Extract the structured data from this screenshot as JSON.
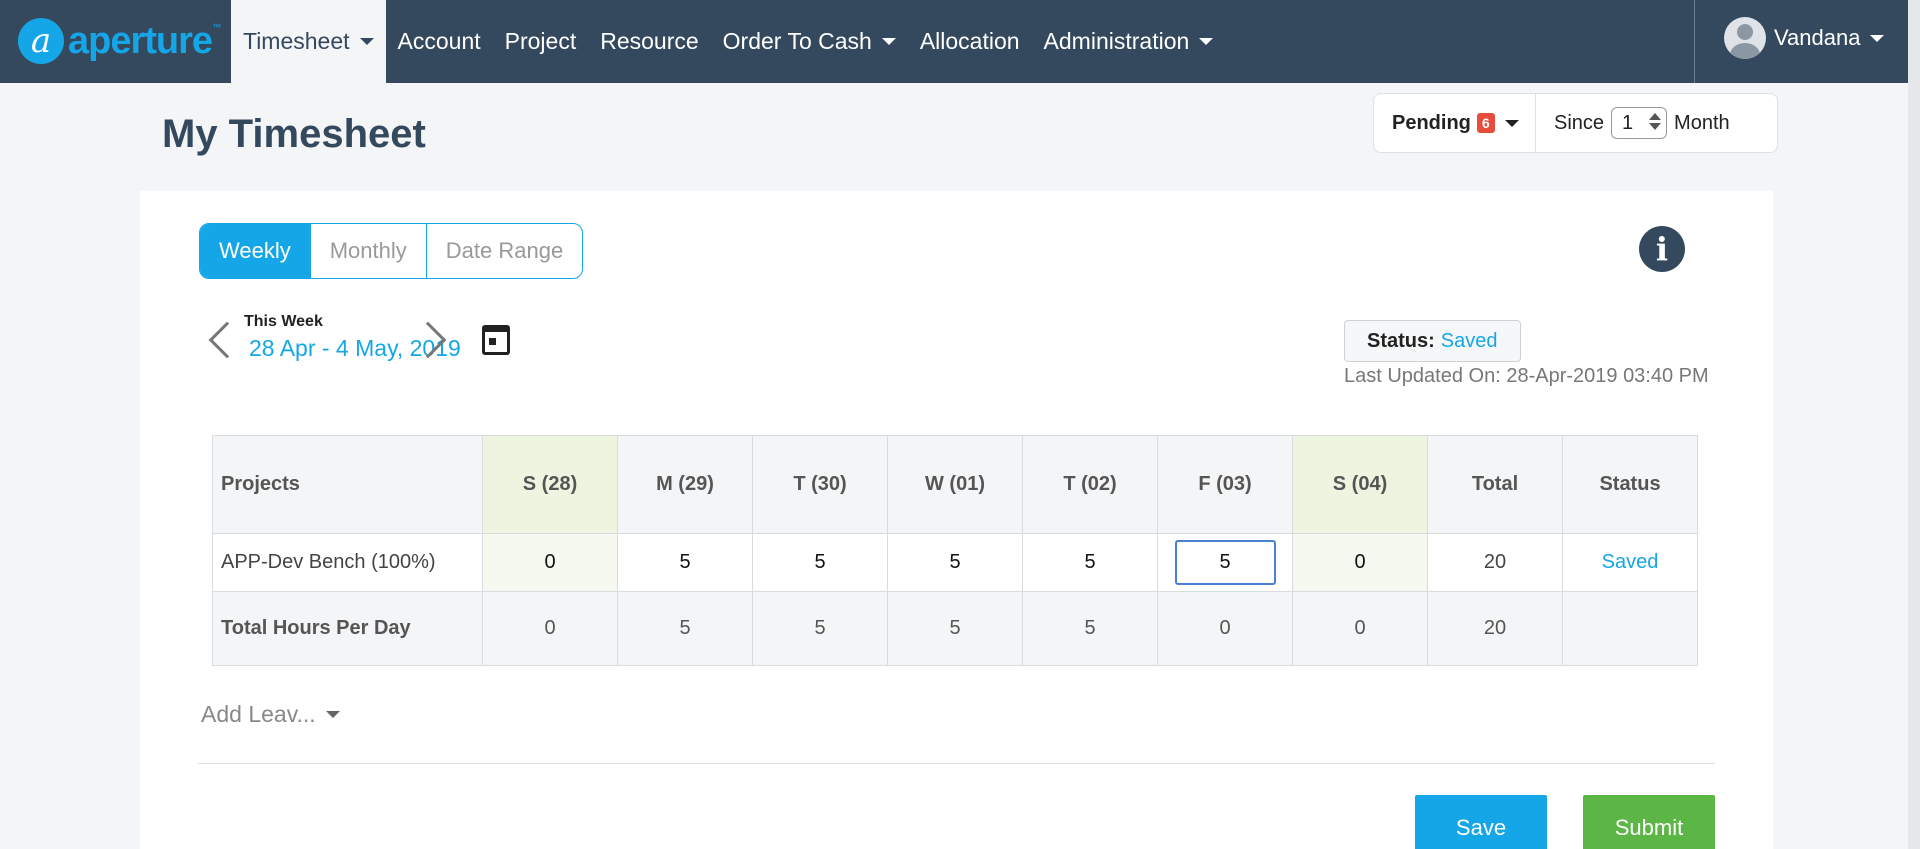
{
  "brand": {
    "mark": "a",
    "name": "aperture",
    "tm": "™"
  },
  "nav": {
    "items": [
      {
        "label": "Timesheet",
        "active": true,
        "dropdown": true
      },
      {
        "label": "Account",
        "active": false,
        "dropdown": false
      },
      {
        "label": "Project",
        "active": false,
        "dropdown": false
      },
      {
        "label": "Resource",
        "active": false,
        "dropdown": false
      },
      {
        "label": "Order To Cash",
        "active": false,
        "dropdown": true
      },
      {
        "label": "Allocation",
        "active": false,
        "dropdown": false
      },
      {
        "label": "Administration",
        "active": false,
        "dropdown": true
      }
    ],
    "user": "Vandana"
  },
  "page": {
    "title": "My Timesheet",
    "pending_label": "Pending",
    "pending_count": "6",
    "since_label": "Since",
    "since_value": "1",
    "since_unit": "Month"
  },
  "view_toggle": {
    "options": [
      "Weekly",
      "Monthly",
      "Date Range"
    ],
    "selected": "Weekly"
  },
  "week": {
    "label": "This Week",
    "range": "28 Apr - 4 May, 2019"
  },
  "status": {
    "label": "Status:",
    "value": "Saved",
    "last_updated": "Last Updated On: 28-Apr-2019 03:40 PM"
  },
  "table": {
    "headers": [
      "Projects",
      "S (28)",
      "M (29)",
      "T (30)",
      "W (01)",
      "T (02)",
      "F (03)",
      "S (04)",
      "Total",
      "Status"
    ],
    "row": {
      "project": "APP-Dev Bench (100%)",
      "hours": [
        "0",
        "5",
        "5",
        "5",
        "5",
        "5",
        "0"
      ],
      "total": "20",
      "status": "Saved"
    },
    "totals": {
      "label": "Total Hours Per Day",
      "hours": [
        "0",
        "5",
        "5",
        "5",
        "5",
        "0",
        "0"
      ],
      "total": "20"
    }
  },
  "add_leave": "Add Leav...",
  "actions": {
    "save": "Save",
    "submit": "Submit"
  },
  "colors": {
    "navbar": "#34495e",
    "accent": "#15a6e8",
    "submit": "#5cb646",
    "badge": "#e74c3c"
  }
}
